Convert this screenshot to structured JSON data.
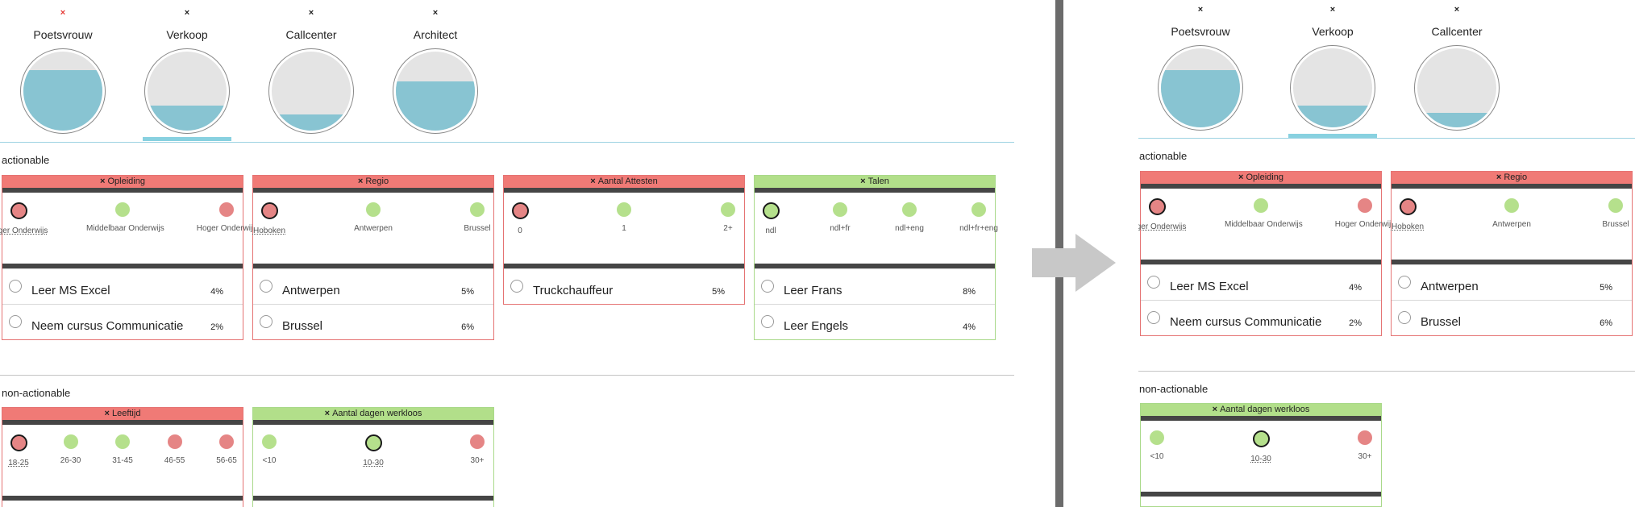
{
  "colors": {
    "accent": "#88c4d2",
    "bad": "#f07a76",
    "good": "#b2df8a",
    "dark_bar": "#454545"
  },
  "left": {
    "gauges": [
      {
        "x": "×",
        "x_color": "#e53935",
        "name": "Poetsvrouw",
        "fill": 0.77,
        "selected": false
      },
      {
        "x": "×",
        "x_color": "#222222",
        "name": "Verkoop",
        "fill": 0.32,
        "selected": true
      },
      {
        "x": "×",
        "x_color": "#222222",
        "name": "Callcenter",
        "fill": 0.2,
        "selected": false
      },
      {
        "x": "×",
        "x_color": "#222222",
        "name": "Architect",
        "fill": 0.62,
        "selected": false
      }
    ],
    "actionable_label": "actionable",
    "non_actionable_label": "non-actionable",
    "cards": [
      {
        "title": "Opleiding",
        "status": "bad",
        "options": [
          {
            "label": "Lager Onderwijs",
            "color": "red",
            "selected": true,
            "underline": true
          },
          {
            "label": "Middelbaar Onderwijs",
            "color": "green",
            "selected": false,
            "underline": false
          },
          {
            "label": "Hoger Onderwijs",
            "color": "red",
            "selected": false,
            "underline": false
          }
        ],
        "recs": [
          {
            "name": "Leer MS Excel",
            "pct": "4%"
          },
          {
            "name": "Neem cursus Communicatie",
            "pct": "2%"
          }
        ]
      },
      {
        "title": "Regio",
        "status": "bad",
        "options": [
          {
            "label": "Hoboken",
            "color": "red",
            "selected": true,
            "underline": true
          },
          {
            "label": "Antwerpen",
            "color": "green",
            "selected": false,
            "underline": false
          },
          {
            "label": "Brussel",
            "color": "green",
            "selected": false,
            "underline": false
          }
        ],
        "recs": [
          {
            "name": "Antwerpen",
            "pct": "5%"
          },
          {
            "name": "Brussel",
            "pct": "6%"
          }
        ]
      },
      {
        "title": "Aantal Attesten",
        "status": "bad",
        "options": [
          {
            "label": "0",
            "color": "red",
            "selected": true,
            "underline": false
          },
          {
            "label": "1",
            "color": "green",
            "selected": false,
            "underline": false
          },
          {
            "label": "2+",
            "color": "green",
            "selected": false,
            "underline": false
          }
        ],
        "recs": [
          {
            "name": "Truckchauffeur",
            "pct": "5%"
          }
        ]
      },
      {
        "title": "Talen",
        "status": "good",
        "options": [
          {
            "label": "ndl",
            "color": "green",
            "selected": true,
            "underline": false
          },
          {
            "label": "ndl+fr",
            "color": "green",
            "selected": false,
            "underline": false
          },
          {
            "label": "ndl+eng",
            "color": "green",
            "selected": false,
            "underline": false
          },
          {
            "label": "ndl+fr+eng",
            "color": "green",
            "selected": false,
            "underline": false
          }
        ],
        "recs": [
          {
            "name": "Leer Frans",
            "pct": "8%"
          },
          {
            "name": "Leer Engels",
            "pct": "4%"
          }
        ]
      }
    ],
    "non_cards": [
      {
        "title": "Leeftijd",
        "status": "bad",
        "options": [
          {
            "label": "18-25",
            "color": "red",
            "selected": true,
            "underline": true
          },
          {
            "label": "26-30",
            "color": "green",
            "selected": false,
            "underline": false
          },
          {
            "label": "31-45",
            "color": "green",
            "selected": false,
            "underline": false
          },
          {
            "label": "46-55",
            "color": "red",
            "selected": false,
            "underline": false
          },
          {
            "label": "56-65",
            "color": "red",
            "selected": false,
            "underline": false
          }
        ]
      },
      {
        "title": "Aantal dagen werkloos",
        "status": "good",
        "options": [
          {
            "label": "<10",
            "color": "green",
            "selected": false,
            "underline": false
          },
          {
            "label": "10-30",
            "color": "green",
            "selected": true,
            "underline": true
          },
          {
            "label": "30+",
            "color": "red",
            "selected": false,
            "underline": false
          }
        ]
      }
    ]
  },
  "right": {
    "gauges": [
      {
        "x": "×",
        "x_color": "#222222",
        "name": "Poetsvrouw",
        "fill": 0.72,
        "selected": false
      },
      {
        "x": "×",
        "x_color": "#222222",
        "name": "Verkoop",
        "fill": 0.28,
        "selected": true
      },
      {
        "x": "×",
        "x_color": "#222222",
        "name": "Callcenter",
        "fill": 0.18,
        "selected": false
      }
    ],
    "actionable_label": "actionable",
    "non_actionable_label": "non-actionable",
    "cards": [
      {
        "title": "Opleiding",
        "status": "bad",
        "options": [
          {
            "label": "Lager Onderwijs",
            "color": "red",
            "selected": true,
            "underline": true
          },
          {
            "label": "Middelbaar Onderwijs",
            "color": "green",
            "selected": false,
            "underline": false
          },
          {
            "label": "Hoger Onderwijs",
            "color": "red",
            "selected": false,
            "underline": false
          }
        ],
        "recs": [
          {
            "name": "Leer MS Excel",
            "pct": "4%"
          },
          {
            "name": "Neem cursus Communicatie",
            "pct": "2%"
          }
        ]
      },
      {
        "title": "Regio",
        "status": "bad",
        "options": [
          {
            "label": "Hoboken",
            "color": "red",
            "selected": true,
            "underline": true
          },
          {
            "label": "Antwerpen",
            "color": "green",
            "selected": false,
            "underline": false
          },
          {
            "label": "Brussel",
            "color": "green",
            "selected": false,
            "underline": false
          }
        ],
        "recs": [
          {
            "name": "Antwerpen",
            "pct": "5%"
          },
          {
            "name": "Brussel",
            "pct": "6%"
          }
        ]
      }
    ],
    "non_cards": [
      {
        "title": "Aantal dagen werkloos",
        "status": "good",
        "options": [
          {
            "label": "<10",
            "color": "green",
            "selected": false,
            "underline": false
          },
          {
            "label": "10-30",
            "color": "green",
            "selected": true,
            "underline": true
          },
          {
            "label": "30+",
            "color": "red",
            "selected": false,
            "underline": false
          }
        ]
      }
    ]
  }
}
